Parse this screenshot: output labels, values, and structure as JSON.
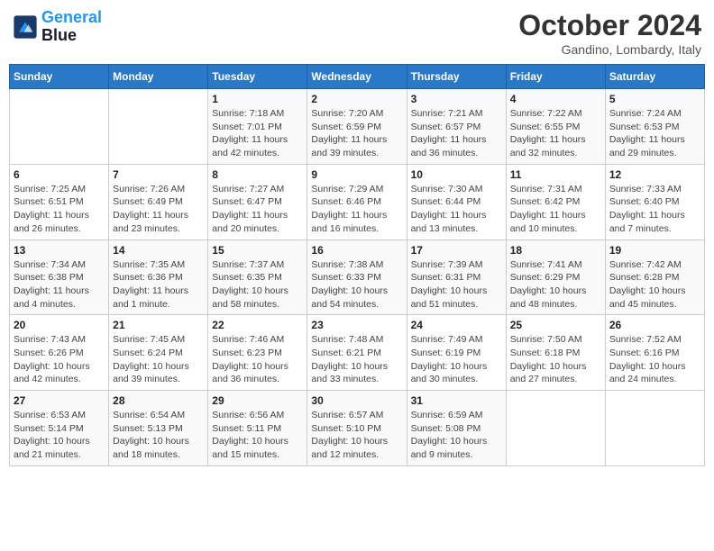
{
  "header": {
    "logo_line1": "General",
    "logo_line2": "Blue",
    "month": "October 2024",
    "location": "Gandino, Lombardy, Italy"
  },
  "weekdays": [
    "Sunday",
    "Monday",
    "Tuesday",
    "Wednesday",
    "Thursday",
    "Friday",
    "Saturday"
  ],
  "weeks": [
    [
      {
        "day": "",
        "detail": ""
      },
      {
        "day": "",
        "detail": ""
      },
      {
        "day": "1",
        "detail": "Sunrise: 7:18 AM\nSunset: 7:01 PM\nDaylight: 11 hours and 42 minutes."
      },
      {
        "day": "2",
        "detail": "Sunrise: 7:20 AM\nSunset: 6:59 PM\nDaylight: 11 hours and 39 minutes."
      },
      {
        "day": "3",
        "detail": "Sunrise: 7:21 AM\nSunset: 6:57 PM\nDaylight: 11 hours and 36 minutes."
      },
      {
        "day": "4",
        "detail": "Sunrise: 7:22 AM\nSunset: 6:55 PM\nDaylight: 11 hours and 32 minutes."
      },
      {
        "day": "5",
        "detail": "Sunrise: 7:24 AM\nSunset: 6:53 PM\nDaylight: 11 hours and 29 minutes."
      }
    ],
    [
      {
        "day": "6",
        "detail": "Sunrise: 7:25 AM\nSunset: 6:51 PM\nDaylight: 11 hours and 26 minutes."
      },
      {
        "day": "7",
        "detail": "Sunrise: 7:26 AM\nSunset: 6:49 PM\nDaylight: 11 hours and 23 minutes."
      },
      {
        "day": "8",
        "detail": "Sunrise: 7:27 AM\nSunset: 6:47 PM\nDaylight: 11 hours and 20 minutes."
      },
      {
        "day": "9",
        "detail": "Sunrise: 7:29 AM\nSunset: 6:46 PM\nDaylight: 11 hours and 16 minutes."
      },
      {
        "day": "10",
        "detail": "Sunrise: 7:30 AM\nSunset: 6:44 PM\nDaylight: 11 hours and 13 minutes."
      },
      {
        "day": "11",
        "detail": "Sunrise: 7:31 AM\nSunset: 6:42 PM\nDaylight: 11 hours and 10 minutes."
      },
      {
        "day": "12",
        "detail": "Sunrise: 7:33 AM\nSunset: 6:40 PM\nDaylight: 11 hours and 7 minutes."
      }
    ],
    [
      {
        "day": "13",
        "detail": "Sunrise: 7:34 AM\nSunset: 6:38 PM\nDaylight: 11 hours and 4 minutes."
      },
      {
        "day": "14",
        "detail": "Sunrise: 7:35 AM\nSunset: 6:36 PM\nDaylight: 11 hours and 1 minute."
      },
      {
        "day": "15",
        "detail": "Sunrise: 7:37 AM\nSunset: 6:35 PM\nDaylight: 10 hours and 58 minutes."
      },
      {
        "day": "16",
        "detail": "Sunrise: 7:38 AM\nSunset: 6:33 PM\nDaylight: 10 hours and 54 minutes."
      },
      {
        "day": "17",
        "detail": "Sunrise: 7:39 AM\nSunset: 6:31 PM\nDaylight: 10 hours and 51 minutes."
      },
      {
        "day": "18",
        "detail": "Sunrise: 7:41 AM\nSunset: 6:29 PM\nDaylight: 10 hours and 48 minutes."
      },
      {
        "day": "19",
        "detail": "Sunrise: 7:42 AM\nSunset: 6:28 PM\nDaylight: 10 hours and 45 minutes."
      }
    ],
    [
      {
        "day": "20",
        "detail": "Sunrise: 7:43 AM\nSunset: 6:26 PM\nDaylight: 10 hours and 42 minutes."
      },
      {
        "day": "21",
        "detail": "Sunrise: 7:45 AM\nSunset: 6:24 PM\nDaylight: 10 hours and 39 minutes."
      },
      {
        "day": "22",
        "detail": "Sunrise: 7:46 AM\nSunset: 6:23 PM\nDaylight: 10 hours and 36 minutes."
      },
      {
        "day": "23",
        "detail": "Sunrise: 7:48 AM\nSunset: 6:21 PM\nDaylight: 10 hours and 33 minutes."
      },
      {
        "day": "24",
        "detail": "Sunrise: 7:49 AM\nSunset: 6:19 PM\nDaylight: 10 hours and 30 minutes."
      },
      {
        "day": "25",
        "detail": "Sunrise: 7:50 AM\nSunset: 6:18 PM\nDaylight: 10 hours and 27 minutes."
      },
      {
        "day": "26",
        "detail": "Sunrise: 7:52 AM\nSunset: 6:16 PM\nDaylight: 10 hours and 24 minutes."
      }
    ],
    [
      {
        "day": "27",
        "detail": "Sunrise: 6:53 AM\nSunset: 5:14 PM\nDaylight: 10 hours and 21 minutes."
      },
      {
        "day": "28",
        "detail": "Sunrise: 6:54 AM\nSunset: 5:13 PM\nDaylight: 10 hours and 18 minutes."
      },
      {
        "day": "29",
        "detail": "Sunrise: 6:56 AM\nSunset: 5:11 PM\nDaylight: 10 hours and 15 minutes."
      },
      {
        "day": "30",
        "detail": "Sunrise: 6:57 AM\nSunset: 5:10 PM\nDaylight: 10 hours and 12 minutes."
      },
      {
        "day": "31",
        "detail": "Sunrise: 6:59 AM\nSunset: 5:08 PM\nDaylight: 10 hours and 9 minutes."
      },
      {
        "day": "",
        "detail": ""
      },
      {
        "day": "",
        "detail": ""
      }
    ]
  ]
}
